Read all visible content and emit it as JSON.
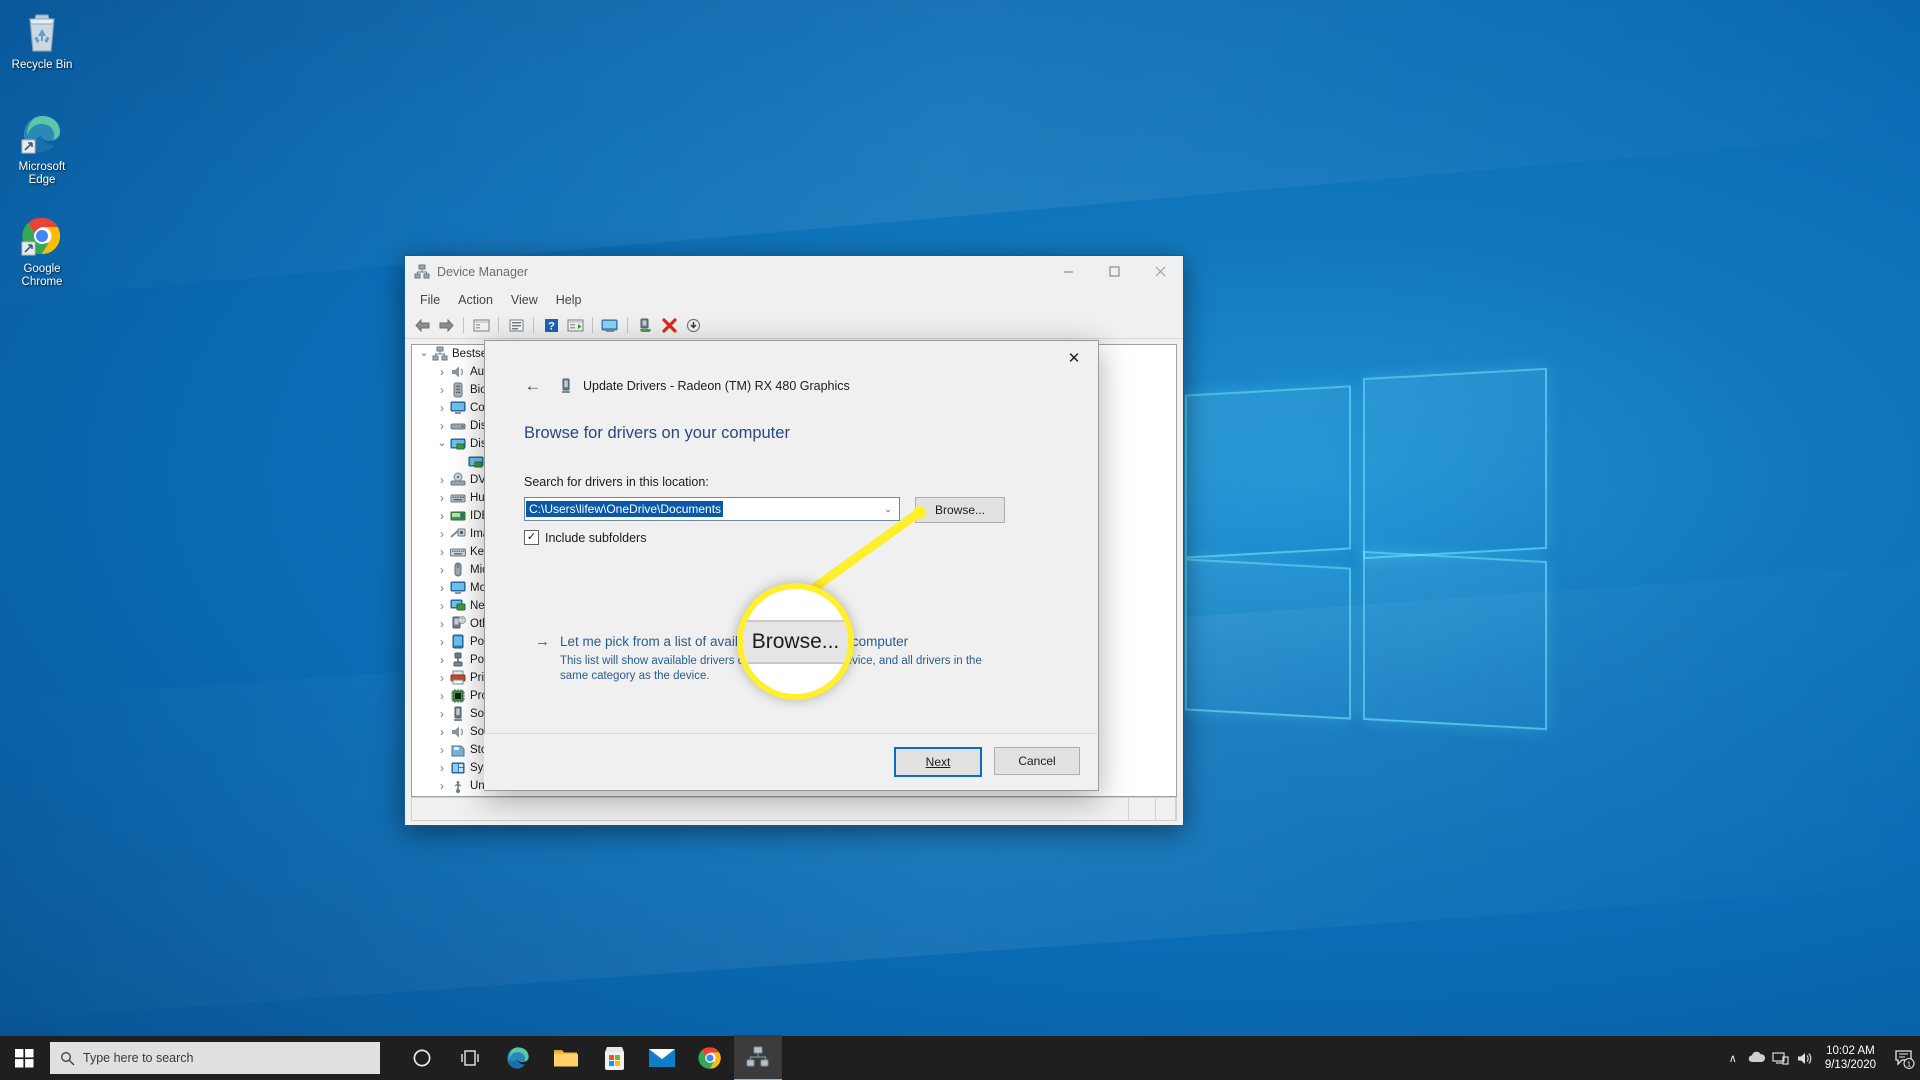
{
  "desktop": {
    "icons": [
      {
        "name": "recycle-bin",
        "label": "Recycle Bin"
      },
      {
        "name": "microsoft-edge",
        "label": "Microsoft\nEdge"
      },
      {
        "name": "google-chrome",
        "label": "Google\nChrome"
      }
    ]
  },
  "device_manager": {
    "title": "Device Manager",
    "window_controls": {
      "minimize": "—",
      "maximize": "☐",
      "close": "✕"
    },
    "menu": [
      "File",
      "Action",
      "View",
      "Help"
    ],
    "toolbar_icons": [
      "back-arrow-icon",
      "forward-arrow-icon",
      "show-hidden-devices-icon",
      "properties-icon",
      "help-icon",
      "scan-hardware-icon",
      "update-driver-icon",
      "disable-device-icon",
      "uninstall-device-icon",
      "install-legacy-icon"
    ],
    "tree": [
      {
        "label": "Bestsel",
        "level": 0,
        "expanded": true,
        "icon": "computer-icon"
      },
      {
        "label": "Auc",
        "level": 1,
        "expanded": false,
        "icon": "audio-icon"
      },
      {
        "label": "Bio",
        "level": 1,
        "expanded": false,
        "icon": "biometric-icon"
      },
      {
        "label": "Cor",
        "level": 1,
        "expanded": false,
        "icon": "monitor-icon"
      },
      {
        "label": "Disk",
        "level": 1,
        "expanded": false,
        "icon": "disk-icon"
      },
      {
        "label": "Disp",
        "level": 1,
        "expanded": true,
        "icon": "display-adapter-icon"
      },
      {
        "label": "",
        "level": 2,
        "expanded": null,
        "icon": "display-adapter-icon"
      },
      {
        "label": "DVD",
        "level": 1,
        "expanded": false,
        "icon": "dvd-icon"
      },
      {
        "label": "Hu",
        "level": 1,
        "expanded": false,
        "icon": "hid-icon"
      },
      {
        "label": "IDE",
        "level": 1,
        "expanded": false,
        "icon": "ide-icon"
      },
      {
        "label": "Ima",
        "level": 1,
        "expanded": false,
        "icon": "imaging-icon"
      },
      {
        "label": "Key",
        "level": 1,
        "expanded": false,
        "icon": "keyboard-icon"
      },
      {
        "label": "Mic",
        "level": 1,
        "expanded": false,
        "icon": "mouse-icon"
      },
      {
        "label": "Mo",
        "level": 1,
        "expanded": false,
        "icon": "monitor-icon"
      },
      {
        "label": "Net",
        "level": 1,
        "expanded": false,
        "icon": "network-icon"
      },
      {
        "label": "Oth",
        "level": 1,
        "expanded": false,
        "icon": "other-devices-icon"
      },
      {
        "label": "Por",
        "level": 1,
        "expanded": false,
        "icon": "portable-device-icon"
      },
      {
        "label": "Por",
        "level": 1,
        "expanded": false,
        "icon": "ports-icon"
      },
      {
        "label": "Prin",
        "level": 1,
        "expanded": false,
        "icon": "printer-icon"
      },
      {
        "label": "Pro",
        "level": 1,
        "expanded": false,
        "icon": "processor-icon"
      },
      {
        "label": "Sof",
        "level": 1,
        "expanded": false,
        "icon": "software-device-icon"
      },
      {
        "label": "Sou",
        "level": 1,
        "expanded": false,
        "icon": "sound-icon"
      },
      {
        "label": "Sto",
        "level": 1,
        "expanded": false,
        "icon": "storage-icon"
      },
      {
        "label": "Sys",
        "level": 1,
        "expanded": false,
        "icon": "system-devices-icon"
      },
      {
        "label": "Uni",
        "level": 1,
        "expanded": false,
        "icon": "usb-icon"
      }
    ]
  },
  "update_drivers_dialog": {
    "close_label": "✕",
    "back_label": "←",
    "header": "Update Drivers - Radeon (TM) RX 480 Graphics",
    "heading": "Browse for drivers on your computer",
    "location_label": "Search for drivers in this location:",
    "location_value": "C:\\Users\\lifew\\OneDrive\\Documents",
    "combo_arrow": "⌄",
    "browse_label": "Browse...",
    "include_subfolders_label": "Include subfolders",
    "include_subfolders_checked": true,
    "checkmark": "✓",
    "pick_arrow": "→",
    "pick_link": "Let me pick from a list of available drivers on my computer",
    "pick_desc": "This list will show available drivers compatible with the device, and all drivers in the same category as the device.",
    "next_label": "Next",
    "next_underline_char": "N",
    "cancel_label": "Cancel",
    "colors": {
      "heading": "#28487f",
      "link": "#2a5d8f",
      "selection": "#0a58a8",
      "primary_border": "#0a6cc4"
    }
  },
  "callout": {
    "magnified_text": "Browse...",
    "highlight_color": "#ffef2e",
    "target": "browse-button"
  },
  "taskbar": {
    "start_label": "start-icon",
    "search_placeholder": "Type here to search",
    "search_icon": "search-icon",
    "tasks": [
      {
        "name": "cortana-icon",
        "label": "Cortana"
      },
      {
        "name": "task-view-icon",
        "label": "Task View"
      },
      {
        "name": "microsoft-edge-icon",
        "label": "Microsoft Edge"
      },
      {
        "name": "file-explorer-icon",
        "label": "File Explorer"
      },
      {
        "name": "microsoft-store-icon",
        "label": "Microsoft Store"
      },
      {
        "name": "mail-icon",
        "label": "Mail"
      },
      {
        "name": "google-chrome-icon",
        "label": "Google Chrome"
      },
      {
        "name": "device-manager-icon",
        "label": "Device Manager"
      }
    ],
    "tray": {
      "chevron": "∧",
      "icons": [
        "onedrive-icon",
        "network-icon",
        "volume-icon"
      ],
      "time": "10:02 AM",
      "date": "9/13/2020",
      "notification_count": "1"
    }
  }
}
